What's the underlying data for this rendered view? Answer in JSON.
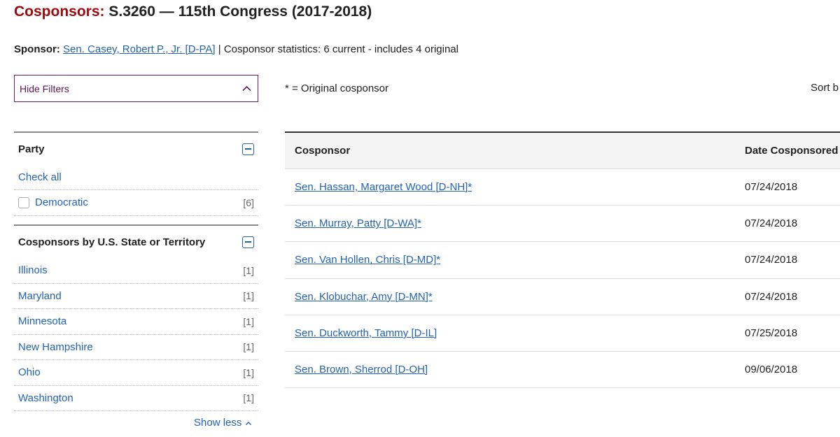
{
  "header": {
    "title_label": "Cosponsors:",
    "title_rest": "S.3260 — 115th Congress (2017-2018)"
  },
  "sponsor": {
    "label": "Sponsor:",
    "name": "Sen. Casey, Robert P., Jr. [D-PA]",
    "stats": "| Cosponsor statistics: 6 current - includes 4 original"
  },
  "filters": {
    "toggle_label": "Hide Filters",
    "party": {
      "title": "Party",
      "check_all": "Check all",
      "items": [
        {
          "label": "Democratic",
          "count": "[6]"
        }
      ]
    },
    "state": {
      "title": "Cosponsors by U.S. State or Territory",
      "items": [
        {
          "label": "Illinois",
          "count": "[1]"
        },
        {
          "label": "Maryland",
          "count": "[1]"
        },
        {
          "label": "Minnesota",
          "count": "[1]"
        },
        {
          "label": "New Hampshire",
          "count": "[1]"
        },
        {
          "label": "Ohio",
          "count": "[1]"
        },
        {
          "label": "Washington",
          "count": "[1]"
        }
      ],
      "show_less": "Show less"
    }
  },
  "legend_note": "* = Original cosponsor",
  "sort_label": "Sort b",
  "table": {
    "columns": [
      "Cosponsor",
      "Date Cosponsored"
    ],
    "rows": [
      {
        "name": "Sen. Hassan, Margaret Wood [D-NH]*",
        "date": "07/24/2018"
      },
      {
        "name": "Sen. Murray, Patty [D-WA]*",
        "date": "07/24/2018"
      },
      {
        "name": "Sen. Van Hollen, Chris [D-MD]*",
        "date": "07/24/2018"
      },
      {
        "name": "Sen. Klobuchar, Amy [D-MN]*",
        "date": "07/24/2018"
      },
      {
        "name": "Sen. Duckworth, Tammy [D-IL]",
        "date": "07/25/2018"
      },
      {
        "name": "Sen. Brown, Sherrod [D-OH]",
        "date": "09/06/2018"
      }
    ]
  },
  "colors": {
    "title_accent": "#9d0b0e",
    "link": "#2262b3",
    "filter_border": "#6b1b5a"
  }
}
